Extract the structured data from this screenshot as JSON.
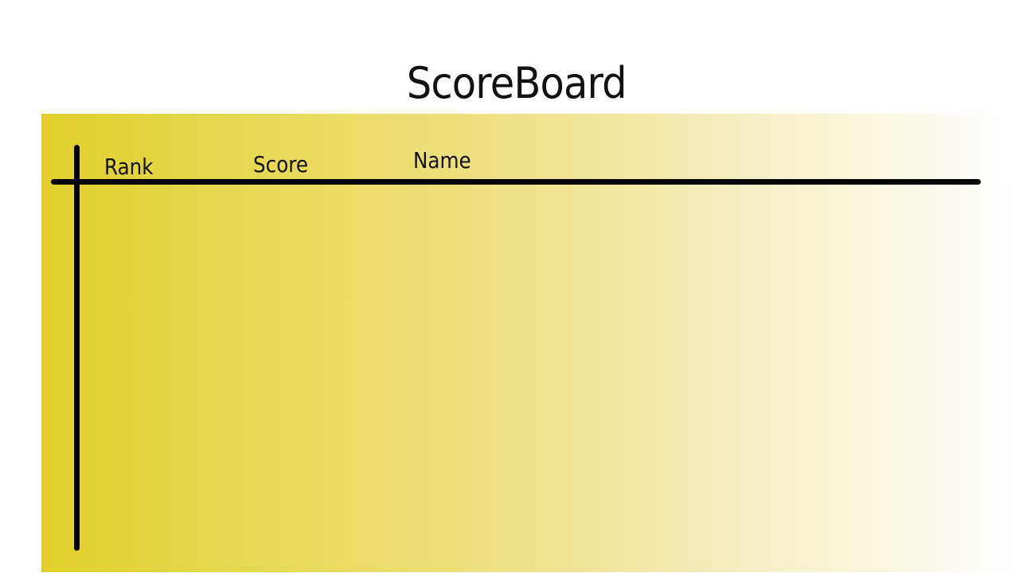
{
  "title": "ScoreBoard",
  "columns": {
    "rank": "Rank",
    "score": "Score",
    "name": "Name"
  },
  "rows": [],
  "colors": {
    "board_start": "#e2cf2b",
    "board_end": "#ffffff",
    "lines": "#050505"
  }
}
